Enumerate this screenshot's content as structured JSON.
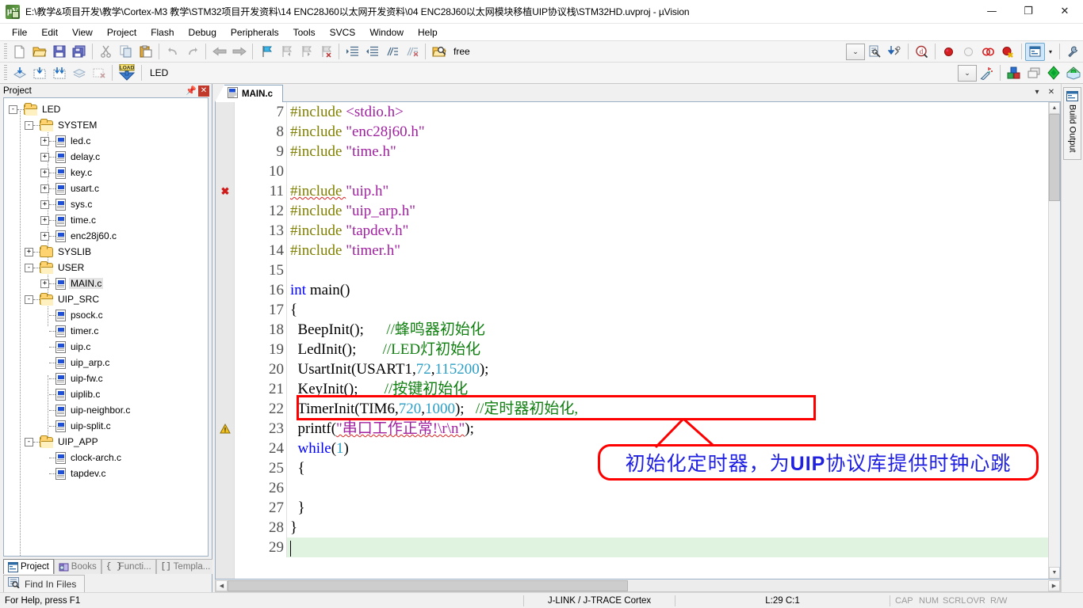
{
  "window": {
    "title": "E:\\教学&项目开发\\教学\\Cortex-M3 教学\\STM32项目开发资料\\14 ENC28J60以太网开发资料\\04 ENC28J60以太网模块移植UIP协议栈\\STM32HD.uvproj - µVision",
    "app_icon": "uvision-icon",
    "minimize": "—",
    "maximize": "❐",
    "close": "✕"
  },
  "menu": {
    "items": [
      "File",
      "Edit",
      "View",
      "Project",
      "Flash",
      "Debug",
      "Peripherals",
      "Tools",
      "SVCS",
      "Window",
      "Help"
    ]
  },
  "toolbar_main": {
    "buttons": [
      "new-file-icon",
      "open-file-icon",
      "save-icon",
      "save-all-icon",
      "cut-icon",
      "copy-icon",
      "paste-icon",
      "undo-icon",
      "redo-icon",
      "navigate-back-icon",
      "navigate-forward-icon",
      "bookmark-toggle-icon",
      "bookmark-prev-icon",
      "bookmark-next-icon",
      "bookmark-clear-icon",
      "indent-icon",
      "outdent-icon",
      "comment-icon",
      "uncomment-icon"
    ],
    "find_icon": "find-in-files-icon",
    "find_value": "free",
    "find_combo_caret": "⌄",
    "incremental_find_icon": "incremental-find-icon",
    "find_down_icon": "find-next-icon",
    "browse_icon": "browse-symbol-icon",
    "breakpoint_icon": "insert-breakpoint-icon",
    "breakpoint_disable_icon": "disable-breakpoint-icon",
    "breakpoint_kill_icon": "kill-all-breakpoints-icon",
    "breakpoint_disable_all_icon": "disable-all-breakpoints-icon",
    "window_layout_icon": "window-layout-icon",
    "window_layout_caret": "▾",
    "config_icon": "configure-icon"
  },
  "toolbar_build": {
    "buttons": [
      "translate-icon",
      "build-target-icon",
      "rebuild-all-icon",
      "batch-build-icon",
      "stop-build-icon",
      "load-icon"
    ],
    "load_label": "LOAD",
    "target_value": "LED",
    "target_caret": "⌄",
    "target_options": [
      "LED"
    ],
    "magic_wand_icon": "target-options-icon",
    "manage_components_icon": "manage-components-icon",
    "multi_project_icon": "manage-multi-project-icon",
    "pack_installer_icon": "pack-installer-icon",
    "pack_manager_icon": "pack-manager-icon"
  },
  "project_panel": {
    "caption": "Project",
    "pin_icon": "pin-icon",
    "close_icon": "close-icon",
    "tree": [
      {
        "label": "LED",
        "depth": 0,
        "toggle": "-",
        "icon": "project-folder",
        "type": "folder"
      },
      {
        "label": "SYSTEM",
        "depth": 1,
        "toggle": "-",
        "icon": "group-folder",
        "type": "folder"
      },
      {
        "label": "led.c",
        "depth": 2,
        "toggle": "+",
        "icon": "c-file",
        "type": "file"
      },
      {
        "label": "delay.c",
        "depth": 2,
        "toggle": "+",
        "icon": "c-file",
        "type": "file"
      },
      {
        "label": "key.c",
        "depth": 2,
        "toggle": "+",
        "icon": "c-file",
        "type": "file"
      },
      {
        "label": "usart.c",
        "depth": 2,
        "toggle": "+",
        "icon": "c-file",
        "type": "file"
      },
      {
        "label": "sys.c",
        "depth": 2,
        "toggle": "+",
        "icon": "c-file",
        "type": "file"
      },
      {
        "label": "time.c",
        "depth": 2,
        "toggle": "+",
        "icon": "c-file",
        "type": "file"
      },
      {
        "label": "enc28j60.c",
        "depth": 2,
        "toggle": "+",
        "icon": "c-file",
        "type": "file"
      },
      {
        "label": "SYSLIB",
        "depth": 1,
        "toggle": "+",
        "icon": "group-folder-closed",
        "type": "folder"
      },
      {
        "label": "USER",
        "depth": 1,
        "toggle": "-",
        "icon": "group-folder",
        "type": "folder"
      },
      {
        "label": "MAIN.c",
        "depth": 2,
        "toggle": "+",
        "icon": "c-file",
        "type": "file",
        "selected": true
      },
      {
        "label": "UIP_SRC",
        "depth": 1,
        "toggle": "-",
        "icon": "group-folder",
        "type": "folder"
      },
      {
        "label": "psock.c",
        "depth": 2,
        "toggle": "",
        "icon": "c-file",
        "type": "file"
      },
      {
        "label": "timer.c",
        "depth": 2,
        "toggle": "",
        "icon": "c-file",
        "type": "file"
      },
      {
        "label": "uip.c",
        "depth": 2,
        "toggle": "",
        "icon": "c-file",
        "type": "file"
      },
      {
        "label": "uip_arp.c",
        "depth": 2,
        "toggle": "",
        "icon": "c-file",
        "type": "file"
      },
      {
        "label": "uip-fw.c",
        "depth": 2,
        "toggle": "",
        "icon": "c-file",
        "type": "file"
      },
      {
        "label": "uiplib.c",
        "depth": 2,
        "toggle": "",
        "icon": "c-file",
        "type": "file"
      },
      {
        "label": "uip-neighbor.c",
        "depth": 2,
        "toggle": "",
        "icon": "c-file",
        "type": "file"
      },
      {
        "label": "uip-split.c",
        "depth": 2,
        "toggle": "",
        "icon": "c-file",
        "type": "file"
      },
      {
        "label": "UIP_APP",
        "depth": 1,
        "toggle": "-",
        "icon": "group-folder",
        "type": "folder"
      },
      {
        "label": "clock-arch.c",
        "depth": 2,
        "toggle": "",
        "icon": "c-file",
        "type": "file"
      },
      {
        "label": "tapdev.c",
        "depth": 2,
        "toggle": "",
        "icon": "c-file",
        "type": "file"
      }
    ],
    "tabs": [
      {
        "label": "Project",
        "icon": "project-tab-icon",
        "selected": true
      },
      {
        "label": "Books",
        "icon": "books-tab-icon",
        "selected": false
      },
      {
        "label": "Functi...",
        "icon": "functions-tab-icon",
        "selected": false
      },
      {
        "label": "Templa...",
        "icon": "templates-tab-icon",
        "selected": false
      }
    ],
    "find_in_files_tab": {
      "label": "Find In Files",
      "icon": "find-in-files-tab-icon"
    }
  },
  "editor": {
    "tab": {
      "label": "MAIN.c",
      "icon": "c-file-icon"
    },
    "tab_menu_icon": "▾",
    "tab_close_icon": "✕",
    "lines": [
      {
        "num": "7",
        "tokens": [
          {
            "t": "#include ",
            "c": "pre"
          },
          {
            "t": "<stdio.h>",
            "c": "str"
          }
        ]
      },
      {
        "num": "8",
        "tokens": [
          {
            "t": "#include ",
            "c": "pre"
          },
          {
            "t": "\"enc28j60.h\"",
            "c": "str"
          }
        ]
      },
      {
        "num": "9",
        "tokens": [
          {
            "t": "#include ",
            "c": "pre"
          },
          {
            "t": "\"time.h\"",
            "c": "str"
          }
        ]
      },
      {
        "num": "10",
        "tokens": []
      },
      {
        "num": "11",
        "tokens": [
          {
            "t": "#include ",
            "c": "pre",
            "squiggle": true
          },
          {
            "t": "\"uip.h\"",
            "c": "str"
          }
        ],
        "marker": "error"
      },
      {
        "num": "12",
        "tokens": [
          {
            "t": "#include ",
            "c": "pre"
          },
          {
            "t": "\"uip_arp.h\"",
            "c": "str"
          }
        ]
      },
      {
        "num": "13",
        "tokens": [
          {
            "t": "#include ",
            "c": "pre"
          },
          {
            "t": "\"tapdev.h\"",
            "c": "str"
          }
        ]
      },
      {
        "num": "14",
        "tokens": [
          {
            "t": "#include ",
            "c": "pre"
          },
          {
            "t": "\"timer.h\"",
            "c": "str"
          }
        ]
      },
      {
        "num": "15",
        "tokens": []
      },
      {
        "num": "16",
        "tokens": [
          {
            "t": "int",
            "c": "kw"
          },
          {
            "t": " main()",
            "c": "txt"
          }
        ]
      },
      {
        "num": "17",
        "tokens": [
          {
            "t": "{",
            "c": "txt"
          }
        ]
      },
      {
        "num": "18",
        "tokens": [
          {
            "t": "  BeepInit();      ",
            "c": "txt"
          },
          {
            "t": "//蜂鸣器初始化",
            "c": "cmt"
          }
        ]
      },
      {
        "num": "19",
        "tokens": [
          {
            "t": "  LedInit();       ",
            "c": "txt"
          },
          {
            "t": "//LED灯初始化",
            "c": "cmt"
          }
        ]
      },
      {
        "num": "20",
        "tokens": [
          {
            "t": "  UsartInit(USART1,",
            "c": "txt"
          },
          {
            "t": "72",
            "c": "num"
          },
          {
            "t": ",",
            "c": "txt"
          },
          {
            "t": "115200",
            "c": "num"
          },
          {
            "t": ");",
            "c": "txt"
          }
        ]
      },
      {
        "num": "21",
        "tokens": [
          {
            "t": "  KeyInit();       ",
            "c": "txt"
          },
          {
            "t": "//按键初始化",
            "c": "cmt"
          }
        ]
      },
      {
        "num": "22",
        "tokens": [
          {
            "t": "  TimerInit(TIM6,",
            "c": "txt"
          },
          {
            "t": "720",
            "c": "num"
          },
          {
            "t": ",",
            "c": "txt"
          },
          {
            "t": "1000",
            "c": "num"
          },
          {
            "t": ");   ",
            "c": "txt"
          },
          {
            "t": "//定时器初始化,",
            "c": "cmt"
          }
        ]
      },
      {
        "num": "23",
        "tokens": [
          {
            "t": "  printf(",
            "c": "txt"
          },
          {
            "t": "\"串口工作正常!\\r\\n\"",
            "c": "str",
            "squiggle": true
          },
          {
            "t": ");",
            "c": "txt"
          }
        ],
        "marker": "warning"
      },
      {
        "num": "24",
        "tokens": [
          {
            "t": "  ",
            "c": "txt"
          },
          {
            "t": "while",
            "c": "kw"
          },
          {
            "t": "(",
            "c": "txt"
          },
          {
            "t": "1",
            "c": "num"
          },
          {
            "t": ")",
            "c": "txt"
          }
        ]
      },
      {
        "num": "25",
        "tokens": [
          {
            "t": "  {",
            "c": "txt"
          }
        ]
      },
      {
        "num": "26",
        "tokens": []
      },
      {
        "num": "27",
        "tokens": [
          {
            "t": "  }",
            "c": "txt"
          }
        ]
      },
      {
        "num": "28",
        "tokens": [
          {
            "t": "}",
            "c": "txt"
          }
        ]
      },
      {
        "num": "29",
        "tokens": [],
        "current": true
      }
    ]
  },
  "annotations": {
    "highlight_rect_line": "22",
    "callout_text_prefix": "初始化定时器，为",
    "callout_text_bold": "UIP",
    "callout_text_suffix": "协议库提供时钟心跳",
    "color": "#ff0000",
    "text_color": "#2020e0"
  },
  "right_dock": {
    "build_output": {
      "label": "Build Output",
      "icon": "build-output-icon"
    }
  },
  "statusbar": {
    "help": "For Help, press F1",
    "debugger": "J-LINK / J-TRACE Cortex",
    "position": "L:29 C:1",
    "flags": [
      "CAP",
      "NUM",
      "SCRL",
      "OVR",
      "R/W"
    ]
  }
}
